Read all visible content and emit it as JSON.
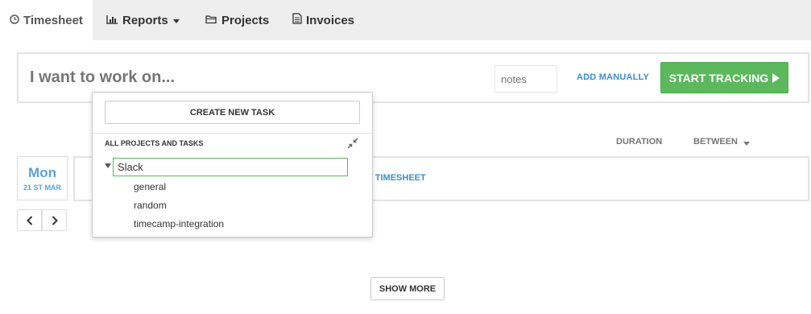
{
  "nav": {
    "tabs": [
      {
        "label": "Timesheet",
        "icon": "clock-icon",
        "active": true
      },
      {
        "label": "Reports",
        "icon": "bar-chart-icon",
        "active": false
      },
      {
        "label": "Projects",
        "icon": "folder-icon",
        "active": false
      },
      {
        "label": "Invoices",
        "icon": "document-icon",
        "active": false
      }
    ]
  },
  "tracker": {
    "task_placeholder": "I want to work on...",
    "notes_placeholder": "notes",
    "add_manually": "ADD MANUALLY",
    "start_tracking": "START TRACKING"
  },
  "dropdown": {
    "create_new_task": "CREATE NEW TASK",
    "section_label": "ALL PROJECTS AND TASKS",
    "project_value": "Slack",
    "subtasks": [
      "general",
      "random",
      "timecamp-integration"
    ]
  },
  "columns": {
    "duration": "DURATION",
    "between": "BETWEEN"
  },
  "day": {
    "name": "Mon",
    "date": "21 ST MAR"
  },
  "entries": {
    "link_text": "T TIMESHEET"
  },
  "show_more": "SHOW MORE",
  "colors": {
    "accent_blue": "#3b8fd1",
    "start_green": "#5cb85c",
    "nav_bg": "#eeeeee"
  }
}
